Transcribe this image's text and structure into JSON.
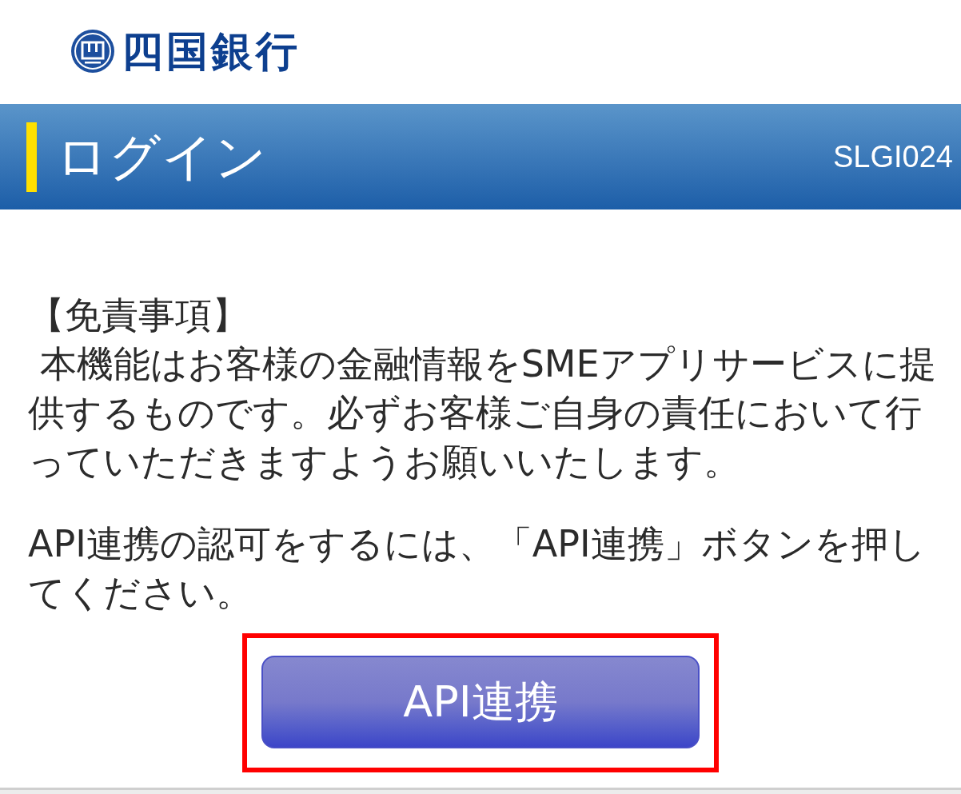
{
  "logo": {
    "bank_name": "四国銀行"
  },
  "header": {
    "title": "ログイン",
    "screen_id": "SLGI024"
  },
  "content": {
    "disclaimer_heading": "【免責事項】",
    "disclaimer_text": " 本機能はお客様の金融情報をSMEアプリサービスに提供するものです。必ずお客様ご自身の責任において行っていただきますようお願いいたします。",
    "instruction": "API連携の認可をするには、「API連携」ボタンを押してください。"
  },
  "button": {
    "label": "API連携",
    "highlighted": true
  }
}
